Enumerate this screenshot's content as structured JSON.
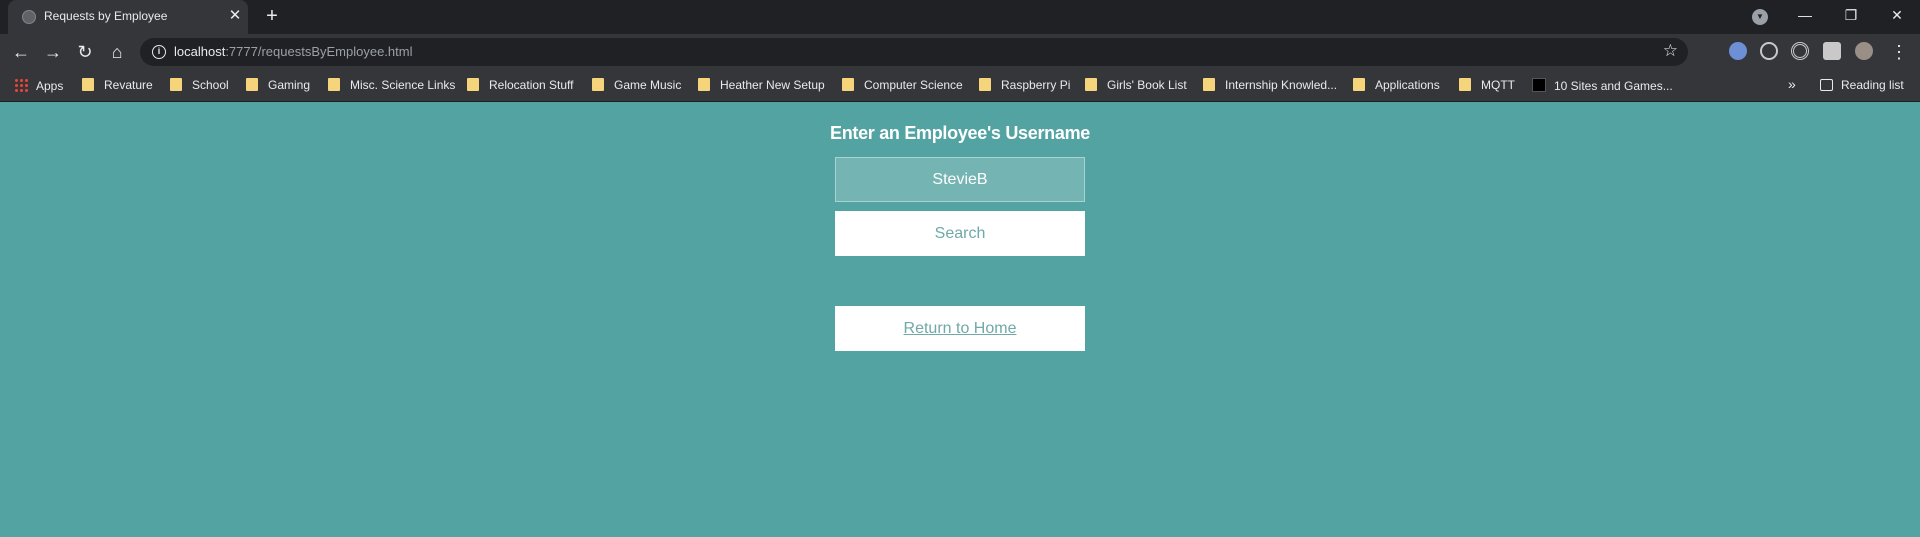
{
  "browser": {
    "tab_title": "Requests by Employee",
    "url_host": "localhost",
    "url_path": ":7777/requestsByEmployee.html",
    "bookmarks": [
      {
        "label": "Apps",
        "icon": "apps-grid-icon"
      },
      {
        "label": "Revature",
        "icon": "folder-icon"
      },
      {
        "label": "School",
        "icon": "folder-icon"
      },
      {
        "label": "Gaming",
        "icon": "folder-icon"
      },
      {
        "label": "Misc. Science Links",
        "icon": "folder-icon"
      },
      {
        "label": "Relocation Stuff",
        "icon": "folder-icon"
      },
      {
        "label": "Game Music",
        "icon": "folder-icon"
      },
      {
        "label": "Heather New Setup",
        "icon": "folder-icon"
      },
      {
        "label": "Computer Science",
        "icon": "folder-icon"
      },
      {
        "label": "Raspberry Pi",
        "icon": "folder-icon"
      },
      {
        "label": "Girls' Book List",
        "icon": "folder-icon"
      },
      {
        "label": "Internship Knowled...",
        "icon": "folder-icon"
      },
      {
        "label": "Applications",
        "icon": "folder-icon"
      },
      {
        "label": "MQTT",
        "icon": "folder-icon"
      },
      {
        "label": "10 Sites and Games...",
        "icon": "site-favicon"
      }
    ],
    "reading_list": "Reading list"
  },
  "page": {
    "heading": "Enter an Employee's Username",
    "username_value": "StevieB",
    "search_label": "Search",
    "home_link_label": "Return to Home"
  },
  "colors": {
    "page_background": "#53a3a3",
    "input_background": "#74b5b3",
    "button_text": "#6fa9a8"
  }
}
